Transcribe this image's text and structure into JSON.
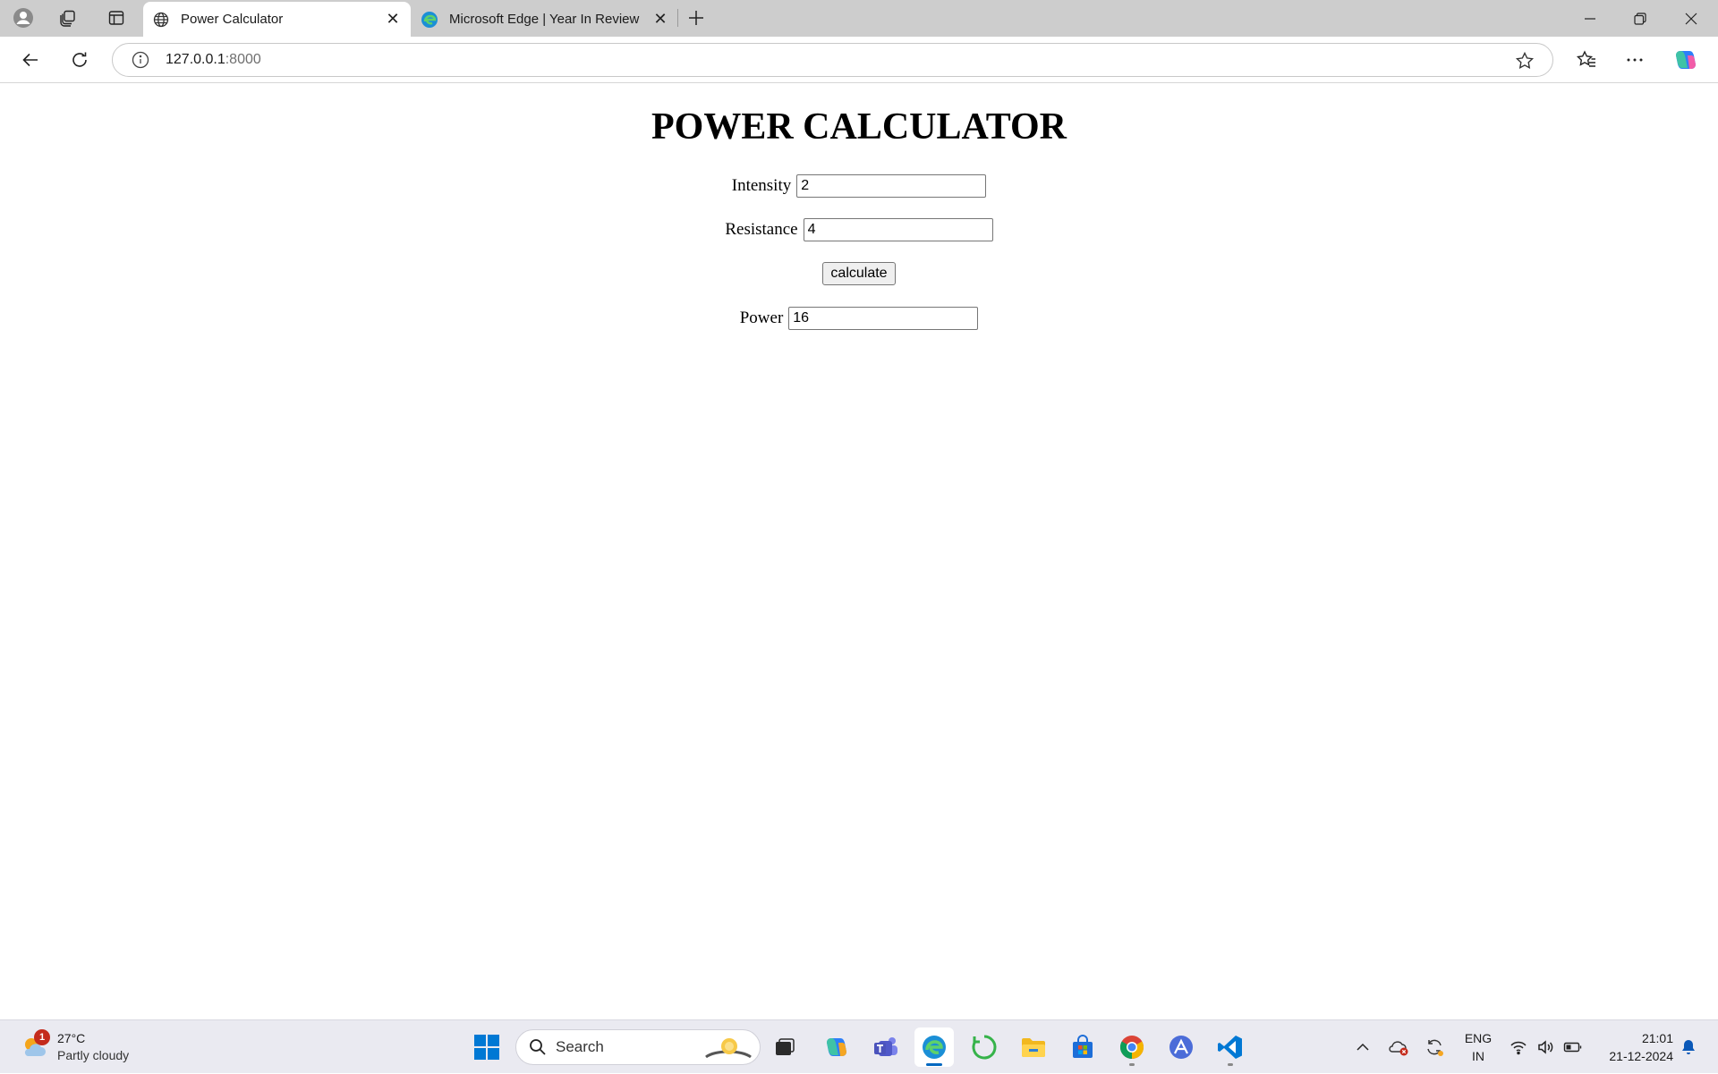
{
  "browser": {
    "tabs": [
      {
        "title": "Power Calculator",
        "active": true
      },
      {
        "title": "Microsoft Edge | Year In Review",
        "active": false
      }
    ],
    "address": {
      "host": "127.0.0.1",
      "port": ":8000"
    }
  },
  "page": {
    "title": "POWER CALCULATOR",
    "fields": {
      "intensity": {
        "label": "Intensity",
        "value": "2"
      },
      "resistance": {
        "label": "Resistance",
        "value": "4"
      },
      "power": {
        "label": "Power",
        "value": "16"
      }
    },
    "calculate_label": "calculate"
  },
  "taskbar": {
    "weather": {
      "temp": "27°C",
      "desc": "Partly cloudy",
      "badge": "1"
    },
    "search_placeholder": "Search",
    "lang": {
      "line1": "ENG",
      "line2": "IN"
    },
    "clock": {
      "time": "21:01",
      "date": "21-12-2024"
    }
  },
  "colors": {
    "accent": "#0067c0",
    "taskbar_bg": "#eaeaf1",
    "tabstrip_bg": "#cdcdcd"
  }
}
